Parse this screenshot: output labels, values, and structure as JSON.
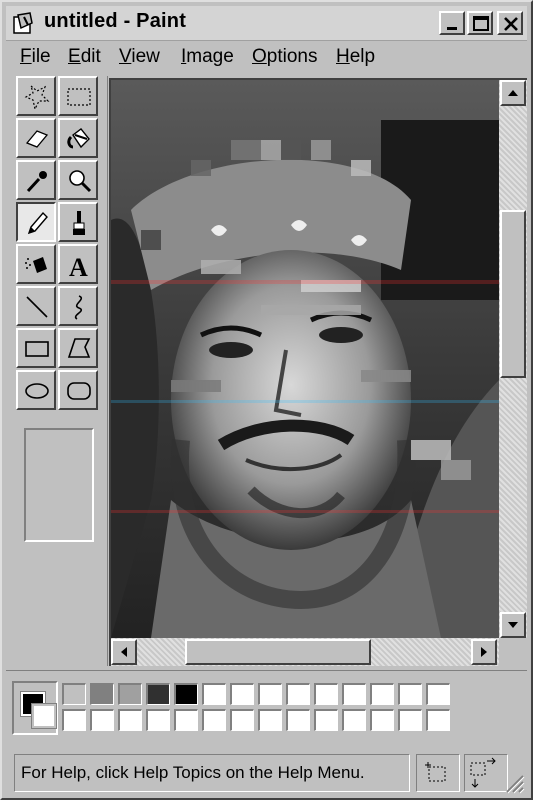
{
  "window": {
    "title": "untitled - Paint",
    "app_icon": "paint-app-icon",
    "controls": [
      "minimize-icon",
      "maximize-icon",
      "close-icon"
    ]
  },
  "menu": [
    {
      "label": "File",
      "mnemonic": "F",
      "rest": "ile"
    },
    {
      "label": "Edit",
      "mnemonic": "E",
      "rest": "dit"
    },
    {
      "label": "View",
      "mnemonic": "V",
      "rest": "iew"
    },
    {
      "label": "Image",
      "mnemonic": "I",
      "rest": "mage"
    },
    {
      "label": "Options",
      "mnemonic": "O",
      "rest": "ptions"
    },
    {
      "label": "Help",
      "mnemonic": "H",
      "rest": "elp"
    }
  ],
  "tools": [
    {
      "name": "free-form-select",
      "icon": "free-form-select-icon"
    },
    {
      "name": "rectangle-select",
      "icon": "rectangle-select-icon"
    },
    {
      "name": "eraser",
      "icon": "eraser-icon"
    },
    {
      "name": "fill-with-color",
      "icon": "fill-bucket-icon"
    },
    {
      "name": "pick-color",
      "icon": "eyedropper-icon"
    },
    {
      "name": "magnifier",
      "icon": "magnifier-icon"
    },
    {
      "name": "pencil",
      "icon": "pencil-icon",
      "selected": true
    },
    {
      "name": "brush",
      "icon": "brush-icon"
    },
    {
      "name": "airbrush",
      "icon": "airbrush-icon"
    },
    {
      "name": "text",
      "icon": "text-icon",
      "glyph": "A"
    },
    {
      "name": "line",
      "icon": "line-icon"
    },
    {
      "name": "curve",
      "icon": "curve-icon"
    },
    {
      "name": "rectangle",
      "icon": "rectangle-icon"
    },
    {
      "name": "polygon",
      "icon": "polygon-icon"
    },
    {
      "name": "ellipse",
      "icon": "ellipse-icon"
    },
    {
      "name": "rounded-rectangle",
      "icon": "rounded-rectangle-icon"
    }
  ],
  "canvas": {
    "content": "glitched-grayscale-portrait-photo"
  },
  "palette": {
    "foreground": "#000000",
    "background": "#ffffff",
    "top_row": [
      "#c0c0c0",
      "#808080",
      "#a0a0a0",
      "#303030",
      "#000000",
      "#ffffff",
      "#ffffff",
      "#ffffff",
      "#ffffff",
      "#ffffff",
      "#ffffff",
      "#ffffff",
      "#ffffff",
      "#ffffff"
    ],
    "bottom_row": [
      "#ffffff",
      "#ffffff",
      "#ffffff",
      "#ffffff",
      "#ffffff",
      "#ffffff",
      "#ffffff",
      "#ffffff",
      "#ffffff",
      "#ffffff",
      "#ffffff",
      "#ffffff",
      "#ffffff",
      "#ffffff"
    ]
  },
  "status": {
    "text": "For Help, click Help Topics on the Help Menu."
  }
}
